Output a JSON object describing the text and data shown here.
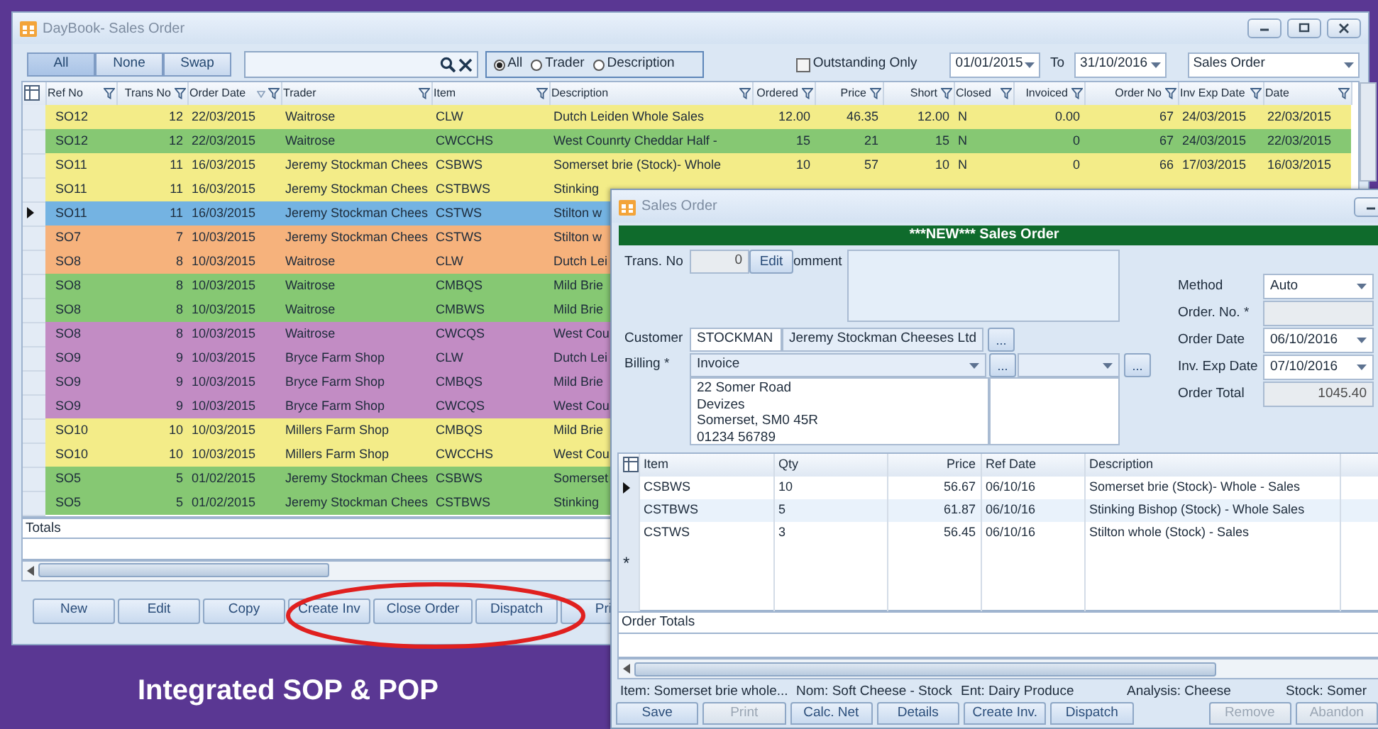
{
  "daybook": {
    "title": "DayBook- Sales Order",
    "filter_buttons": [
      {
        "label": "All",
        "selected": true
      },
      {
        "label": "None",
        "selected": false
      },
      {
        "label": "Swap",
        "selected": false
      }
    ],
    "search_scope": [
      {
        "label": "All",
        "selected": true
      },
      {
        "label": "Trader",
        "selected": false
      },
      {
        "label": "Description",
        "selected": false
      }
    ],
    "outstanding_only": {
      "label": "Outstanding Only",
      "checked": false
    },
    "date_from": "01/01/2015",
    "to_label": "To",
    "date_to": "31/10/2016",
    "document_type": "Sales Order",
    "columns": [
      {
        "label": "Ref No",
        "kind": "text",
        "sorted": false
      },
      {
        "label": "Trans No",
        "kind": "number",
        "sorted": false
      },
      {
        "label": "Order Date",
        "kind": "text",
        "sorted": true
      },
      {
        "label": "Trader",
        "kind": "text",
        "sorted": false
      },
      {
        "label": "Item",
        "kind": "text",
        "sorted": false
      },
      {
        "label": "Description",
        "kind": "text",
        "sorted": false
      },
      {
        "label": "Ordered",
        "kind": "number",
        "sorted": false
      },
      {
        "label": "Price",
        "kind": "number",
        "sorted": false
      },
      {
        "label": "Short",
        "kind": "number",
        "sorted": false
      },
      {
        "label": "Closed",
        "kind": "text",
        "sorted": false
      },
      {
        "label": "Invoiced",
        "kind": "number",
        "sorted": false
      },
      {
        "label": "Order No",
        "kind": "number",
        "sorted": false
      },
      {
        "label": "Inv Exp Date",
        "kind": "text",
        "sorted": false
      },
      {
        "label": "Date",
        "kind": "text",
        "sorted": false
      }
    ],
    "rows": [
      {
        "cells": [
          "SO12",
          "12",
          "22/03/2015",
          "Waitrose",
          "CLW",
          "Dutch Leiden Whole Sales",
          "12.00",
          "46.35",
          "12.00",
          "N",
          "0.00",
          "67",
          "24/03/2015",
          "22/03/2015"
        ],
        "color": "#f3ec88",
        "selected": false
      },
      {
        "cells": [
          "SO12",
          "12",
          "22/03/2015",
          "Waitrose",
          "CWCCHS",
          "West Counrty Cheddar Half -",
          "15",
          "21",
          "15",
          "N",
          "0",
          "67",
          "24/03/2015",
          "22/03/2015"
        ],
        "color": "#86c873",
        "selected": false
      },
      {
        "cells": [
          "SO11",
          "11",
          "16/03/2015",
          "Jeremy Stockman Chees",
          "CSBWS",
          "Somerset brie  (Stock)- Whole",
          "10",
          "57",
          "10",
          "N",
          "0",
          "66",
          "17/03/2015",
          "16/03/2015"
        ],
        "color": "#f3ec88",
        "selected": false
      },
      {
        "cells": [
          "SO11",
          "11",
          "16/03/2015",
          "Jeremy Stockman Chees",
          "CSTBWS",
          "Stinking"
        ],
        "color": "#f3ec88",
        "selected": false
      },
      {
        "cells": [
          "SO11",
          "11",
          "16/03/2015",
          "Jeremy Stockman Chees",
          "CSTWS",
          "Stilton w"
        ],
        "color": "#74b3e2",
        "selected": true
      },
      {
        "cells": [
          "SO7",
          "7",
          "10/03/2015",
          "Jeremy Stockman Chees",
          "CSTWS",
          "Stilton w"
        ],
        "color": "#f6b27c",
        "selected": false
      },
      {
        "cells": [
          "SO8",
          "8",
          "10/03/2015",
          "Waitrose",
          "CLW",
          "Dutch Lei"
        ],
        "color": "#f6b27c",
        "selected": false
      },
      {
        "cells": [
          "SO8",
          "8",
          "10/03/2015",
          "Waitrose",
          "CMBQS",
          "Mild Brie"
        ],
        "color": "#86c873",
        "selected": false
      },
      {
        "cells": [
          "SO8",
          "8",
          "10/03/2015",
          "Waitrose",
          "CMBWS",
          "Mild Brie"
        ],
        "color": "#86c873",
        "selected": false
      },
      {
        "cells": [
          "SO8",
          "8",
          "10/03/2015",
          "Waitrose",
          "CWCQS",
          "West Cou"
        ],
        "color": "#c28cc4",
        "selected": false
      },
      {
        "cells": [
          "SO9",
          "9",
          "10/03/2015",
          "Bryce Farm Shop",
          "CLW",
          "Dutch Lei"
        ],
        "color": "#c28cc4",
        "selected": false
      },
      {
        "cells": [
          "SO9",
          "9",
          "10/03/2015",
          "Bryce Farm Shop",
          "CMBQS",
          "Mild Brie"
        ],
        "color": "#c28cc4",
        "selected": false
      },
      {
        "cells": [
          "SO9",
          "9",
          "10/03/2015",
          "Bryce Farm Shop",
          "CWCQS",
          "West Cou"
        ],
        "color": "#c28cc4",
        "selected": false
      },
      {
        "cells": [
          "SO10",
          "10",
          "10/03/2015",
          "Millers Farm Shop",
          "CMBQS",
          "Mild Brie"
        ],
        "color": "#f3ec88",
        "selected": false
      },
      {
        "cells": [
          "SO10",
          "10",
          "10/03/2015",
          "Millers Farm Shop",
          "CWCCHS",
          "West Cou"
        ],
        "color": "#f3ec88",
        "selected": false
      },
      {
        "cells": [
          "SO5",
          "5",
          "01/02/2015",
          "Jeremy Stockman Chees",
          "CSBWS",
          "Somerset"
        ],
        "color": "#86c873",
        "selected": false
      },
      {
        "cells": [
          "SO5",
          "5",
          "01/02/2015",
          "Jeremy Stockman Chees",
          "CSTBWS",
          "Stinking"
        ],
        "color": "#86c873",
        "selected": false
      }
    ],
    "totals_label": "Totals",
    "buttons": [
      "New",
      "Edit",
      "Copy",
      "Create Inv",
      "Close Order",
      "Dispatch",
      "Pri"
    ]
  },
  "sales_order": {
    "title": "Sales Order",
    "banner": "***NEW*** Sales Order",
    "trans_no_label": "Trans. No",
    "trans_no": "0",
    "edit_button": "Edit",
    "comment_label": "omment",
    "customer_label": "Customer",
    "customer_code": "STOCKMAN",
    "customer_name": "Jeremy Stockman Cheeses Ltd",
    "customer_lookup": "...",
    "billing_label": "Billing *",
    "billing": "Invoice",
    "billing_lookup": "...",
    "delivery_lookup": "...",
    "address_lines": [
      "22 Somer Road",
      "Devizes",
      "Somerset, SM0 45R",
      "01234 56789"
    ],
    "header_fields": [
      {
        "label": "Method",
        "value": "Auto",
        "kind": "select"
      },
      {
        "label": "Order. No. *",
        "kind": "readonly"
      },
      {
        "label": "Order Date",
        "value": "06/10/2016",
        "kind": "select"
      },
      {
        "label": "Inv. Exp Date",
        "value": "07/10/2016",
        "kind": "select"
      },
      {
        "label": "Order Total",
        "value": "1045.40",
        "kind": "readonly"
      }
    ],
    "columns": [
      {
        "label": "Item",
        "kind": "text"
      },
      {
        "label": "Qty",
        "kind": "text"
      },
      {
        "label": "Price",
        "kind": "number"
      },
      {
        "label": "Ref Date",
        "kind": "text"
      },
      {
        "label": "Description",
        "kind": "text"
      }
    ],
    "lines": [
      {
        "cells": [
          "CSBWS",
          "10",
          "56.67",
          "06/10/16",
          "Somerset brie  (Stock)- Whole - Sales"
        ],
        "selected": true
      },
      {
        "cells": [
          "CSTBWS",
          "5",
          "61.87",
          "06/10/16",
          "Stinking Bishop (Stock) - Whole Sales"
        ],
        "selected": false
      },
      {
        "cells": [
          "CSTWS",
          "3",
          "56.45",
          "06/10/16",
          "Stilton whole (Stock) - Sales"
        ],
        "selected": false
      }
    ],
    "new_row_marker": "*",
    "totals_label": "Order Totals",
    "status": [
      "Item: Somerset brie whole...",
      "Nom: Soft Cheese - Stock",
      "Ent: Dairy Produce",
      "Analysis: Cheese",
      "Stock: Somer"
    ],
    "buttons": [
      {
        "label": "Save",
        "disabled": false
      },
      {
        "label": "Print",
        "disabled": true
      },
      {
        "label": "Calc. Net",
        "disabled": false
      },
      {
        "label": "Details",
        "disabled": false
      },
      {
        "label": "Create Inv.",
        "disabled": false
      },
      {
        "label": "Dispatch",
        "disabled": false
      },
      {
        "label": "Remove",
        "disabled": true
      },
      {
        "label": "Abandon",
        "disabled": true
      }
    ]
  },
  "caption": "Integrated SOP & POP"
}
